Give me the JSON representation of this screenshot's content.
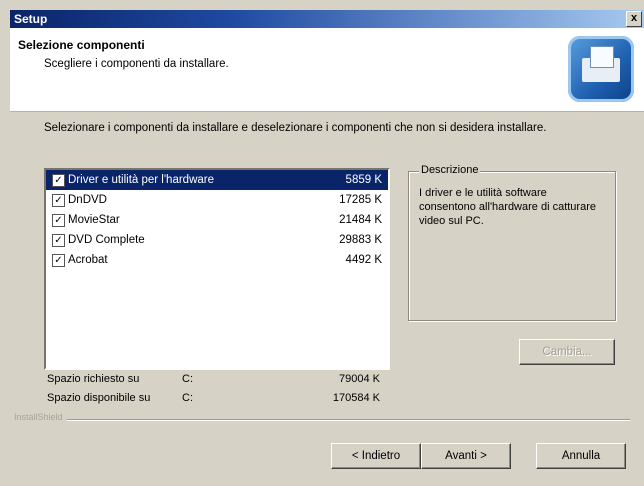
{
  "window": {
    "title": "Setup",
    "close_glyph": "x"
  },
  "header": {
    "title": "Selezione componenti",
    "subtitle": "Scegliere i componenti da installare."
  },
  "intro": "Selezionare i componenti da installare e deselezionare i componenti che non si desidera installare.",
  "components": [
    {
      "label": "Driver e utilità per l'hardware",
      "size": "5859 K",
      "checked": true,
      "selected": true
    },
    {
      "label": "DnDVD",
      "size": "17285 K",
      "checked": true,
      "selected": false
    },
    {
      "label": "MovieStar",
      "size": "21484 K",
      "checked": true,
      "selected": false
    },
    {
      "label": "DVD Complete",
      "size": "29883 K",
      "checked": true,
      "selected": false
    },
    {
      "label": "Acrobat",
      "size": "4492 K",
      "checked": true,
      "selected": false
    }
  ],
  "description": {
    "legend": "Descrizione",
    "text": "I driver e le utilità software consentono all'hardware di catturare video sul PC."
  },
  "buttons": {
    "change": "Cambia...",
    "back": "< Indietro",
    "next": "Avanti >",
    "cancel": "Annulla"
  },
  "space": {
    "required_label": "Spazio richiesto su",
    "required_drive": "C:",
    "required_value": "79004 K",
    "available_label": "Spazio disponibile su",
    "available_drive": "C:",
    "available_value": "170584 K"
  },
  "brand": "InstallShield"
}
